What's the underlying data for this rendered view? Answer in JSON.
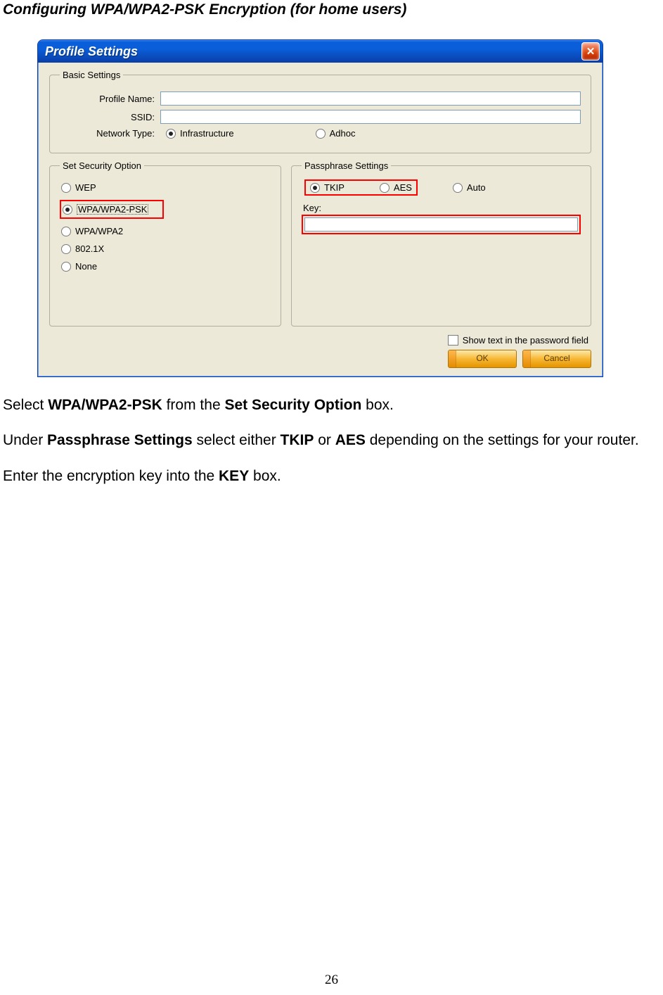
{
  "heading": "Configuring WPA/WPA2-PSK Encryption (for home users)",
  "window": {
    "title": "Profile Settings",
    "close_glyph": "✕",
    "basic": {
      "legend": "Basic Settings",
      "profile_label": "Profile Name:",
      "profile_value": "",
      "ssid_label": "SSID:",
      "ssid_value": "",
      "nettype_label": "Network Type:",
      "infra_label": "Infrastructure",
      "adhoc_label": "Adhoc"
    },
    "security": {
      "legend": "Set Security Option",
      "wep": "WEP",
      "wpapsk": "WPA/WPA2-PSK",
      "wpa": "WPA/WPA2",
      "dot1x": "802.1X",
      "none": "None"
    },
    "passphrase": {
      "legend": "Passphrase Settings",
      "tkip": "TKIP",
      "aes": "AES",
      "auto": "Auto",
      "key_label": "Key:",
      "key_value": ""
    },
    "showtext_label": "Show text in the password field",
    "ok_label": "OK",
    "cancel_label": "Cancel"
  },
  "instructions": {
    "p1_pre": "Select ",
    "p1_bold1": "WPA/WPA2-PSK",
    "p1_mid": " from the ",
    "p1_bold2": "Set Security Option",
    "p1_post": " box.",
    "p2_pre": "Under ",
    "p2_bold1": "Passphrase Settings",
    "p2_mid1": " select either ",
    "p2_bold2": "TKIP",
    "p2_mid2": " or ",
    "p2_bold3": "AES",
    "p2_post": " depending on the settings for your router.",
    "p3_pre": "Enter the encryption key into the ",
    "p3_bold": "KEY",
    "p3_post": " box."
  },
  "page_number": "26"
}
